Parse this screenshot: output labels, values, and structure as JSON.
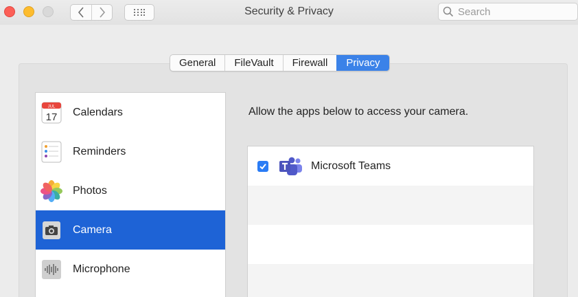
{
  "window": {
    "title": "Security & Privacy",
    "back_icon": "chevron-left-icon",
    "forward_icon": "chevron-right-icon",
    "grid_icon": "grid-icon"
  },
  "search": {
    "placeholder": "Search",
    "icon": "magnifier-icon"
  },
  "tabs": [
    {
      "label": "General",
      "active": false
    },
    {
      "label": "FileVault",
      "active": false
    },
    {
      "label": "Firewall",
      "active": false
    },
    {
      "label": "Privacy",
      "active": true
    }
  ],
  "sidebar": {
    "items": [
      {
        "label": "Calendars",
        "icon": "calendar-icon",
        "selected": false,
        "icon_text_month": "JUL",
        "icon_text_day": "17"
      },
      {
        "label": "Reminders",
        "icon": "reminders-icon",
        "selected": false
      },
      {
        "label": "Photos",
        "icon": "photos-icon",
        "selected": false
      },
      {
        "label": "Camera",
        "icon": "camera-icon",
        "selected": true
      },
      {
        "label": "Microphone",
        "icon": "microphone-icon",
        "selected": false
      }
    ]
  },
  "main": {
    "caption": "Allow the apps below to access your camera.",
    "apps": [
      {
        "name": "Microsoft Teams",
        "checked": true,
        "icon": "microsoft-teams-icon"
      }
    ]
  },
  "colors": {
    "accent": "#3b82e8",
    "selection": "#1e63d6",
    "close": "#fc5f57",
    "minimize": "#fdbc2e"
  }
}
